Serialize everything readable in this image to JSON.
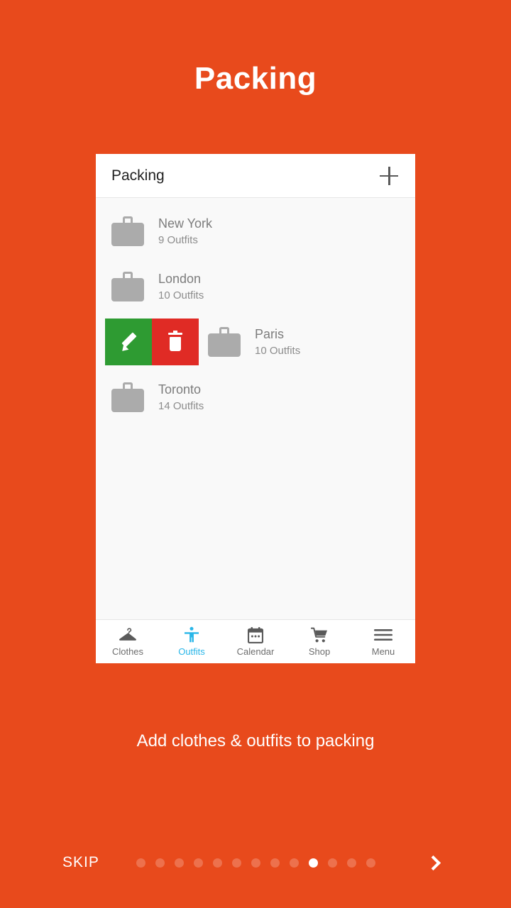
{
  "onboarding": {
    "title": "Packing",
    "tagline": "Add clothes & outfits to packing",
    "skip_label": "SKIP",
    "next_icon": "chevron-right-icon",
    "dots_total": 13,
    "dots_active_index": 9
  },
  "colors": {
    "background": "#E84A1C",
    "card": "#F9F9F9",
    "card_header": "#FFFFFF",
    "edit_green": "#2E9B32",
    "delete_red": "#E02B25",
    "tab_active": "#29B6E8",
    "icon_grey": "#ABABAB",
    "text_grey": "#7C7C7C"
  },
  "app": {
    "header": {
      "title": "Packing",
      "add_icon": "plus-icon"
    },
    "list": [
      {
        "icon": "briefcase-icon",
        "name": "New York",
        "outfits": "9 Outfits",
        "swiped": false
      },
      {
        "icon": "briefcase-icon",
        "name": "London",
        "outfits": "10 Outfits",
        "swiped": false
      },
      {
        "icon": "briefcase-icon",
        "name": "Paris",
        "outfits": "10 Outfits",
        "swiped": true
      },
      {
        "icon": "briefcase-icon",
        "name": "Toronto",
        "outfits": "14 Outfits",
        "swiped": false
      }
    ],
    "swipe_actions": {
      "edit_icon": "pencil-icon",
      "delete_icon": "trash-icon"
    },
    "tabs": [
      {
        "label": "Clothes",
        "icon": "hanger-icon",
        "active": false
      },
      {
        "label": "Outfits",
        "icon": "person-icon",
        "active": true
      },
      {
        "label": "Calendar",
        "icon": "calendar-icon",
        "active": false
      },
      {
        "label": "Shop",
        "icon": "cart-icon",
        "active": false
      },
      {
        "label": "Menu",
        "icon": "hamburger-icon",
        "active": false
      }
    ]
  }
}
